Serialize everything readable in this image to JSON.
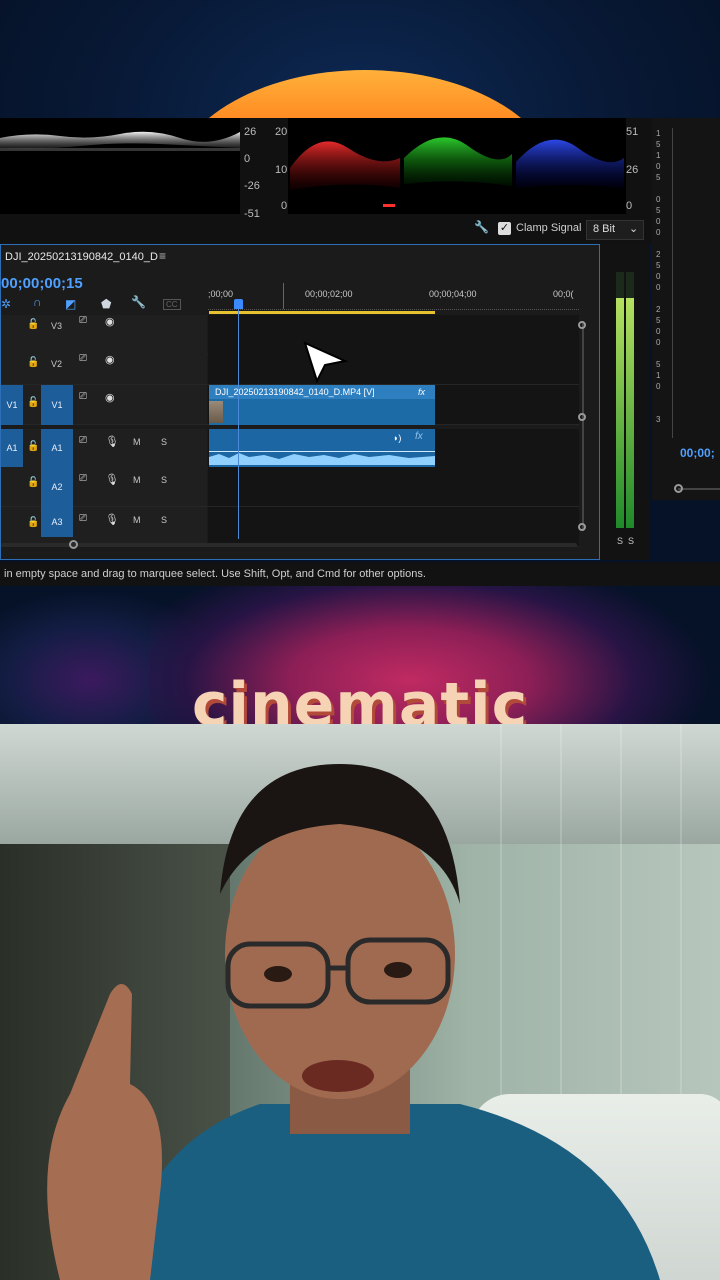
{
  "scopes": {
    "luma_labels": [
      "26",
      "0",
      "-26",
      "-51"
    ],
    "parade_left_labels": [
      "20",
      "10",
      "0"
    ],
    "parade_right_labels": [
      "51",
      "26",
      "0"
    ],
    "clamp_label": "Clamp Signal",
    "bit_depth": "8 Bit",
    "colors": {
      "red": "#ff2020",
      "green": "#19d019",
      "blue": "#2040ff"
    }
  },
  "timeline": {
    "sequence_name": "DJI_20250213190842_0140_D",
    "menu_icon": "≡",
    "timecode": "00;00;00;15",
    "ruler": [
      ";00;00",
      "00;00;02;00",
      "00;00;04;00",
      "00;0("
    ],
    "tracks": [
      {
        "id": "V3",
        "target": "",
        "label": "V3",
        "controls": [
          "lock-icon",
          "film-icon",
          "eye-icon"
        ]
      },
      {
        "id": "V2",
        "target": "",
        "label": "V2",
        "controls": [
          "lock-icon",
          "film-icon",
          "eye-icon"
        ]
      },
      {
        "id": "V1",
        "target": "V1",
        "label": "V1",
        "controls": [
          "lock-icon",
          "film-icon",
          "eye-icon"
        ]
      },
      {
        "id": "A1",
        "target": "A1",
        "label": "A1",
        "controls": [
          "lock-icon",
          "film-icon",
          "mic-icon",
          "M",
          "S"
        ]
      },
      {
        "id": "A2",
        "target": "",
        "label": "A2",
        "controls": [
          "lock-icon",
          "film-icon",
          "mic-icon",
          "M",
          "S"
        ]
      },
      {
        "id": "A3",
        "target": "",
        "label": "A3",
        "controls": [
          "lock-icon",
          "film-icon",
          "mic-icon",
          "M",
          "S"
        ]
      }
    ],
    "video_clip_name": "DJI_20250213190842_0140_D.MP4 [V]",
    "fx": "fx",
    "accent": "#2c6fb6"
  },
  "meter": {
    "solo_labels": [
      "S",
      "S"
    ],
    "level_fraction": 0.9
  },
  "right_panel": {
    "timecode": "00;00;"
  },
  "status": "in empty space and drag to marquee select. Use Shift, Opt, and Cmd for other options.",
  "caption": "cinematic"
}
